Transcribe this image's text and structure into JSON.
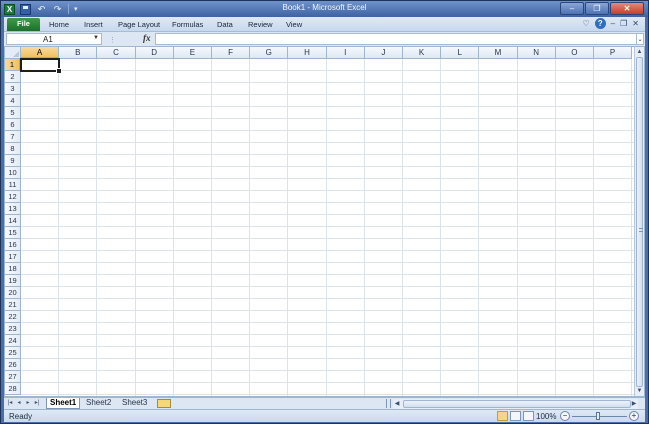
{
  "window": {
    "title": "Book1 - Microsoft Excel",
    "controls": [
      "–",
      "❐",
      "✕"
    ]
  },
  "quick_access": {
    "logo": "X",
    "undo": "↶",
    "redo": "↷",
    "more": "▾"
  },
  "ribbon": {
    "tabs": [
      "File",
      "Home",
      "Insert",
      "Page Layout",
      "Formulas",
      "Data",
      "Review",
      "View"
    ],
    "right_icons": [
      "♡",
      "?",
      "–",
      "❐",
      "✕"
    ]
  },
  "formula_bar": {
    "name_box": "A1",
    "fx": "fx",
    "value": ""
  },
  "grid": {
    "columns": [
      "A",
      "B",
      "C",
      "D",
      "E",
      "F",
      "G",
      "H",
      "I",
      "J",
      "K",
      "L",
      "M",
      "N",
      "O",
      "P"
    ],
    "rows": [
      "1",
      "2",
      "3",
      "4",
      "5",
      "6",
      "7",
      "8",
      "9",
      "10",
      "11",
      "12",
      "13",
      "14",
      "15",
      "16",
      "17",
      "18",
      "19",
      "20",
      "21",
      "22",
      "23",
      "24",
      "25",
      "26",
      "27",
      "28"
    ],
    "selected_cell": "A1",
    "selected_column": "A",
    "selected_row": "1"
  },
  "sheet_tabs": {
    "tabs": [
      "Sheet1",
      "Sheet2",
      "Sheet3"
    ],
    "active": "Sheet1",
    "nav": [
      "|◂",
      "◂",
      "▸",
      "▸|"
    ]
  },
  "status_bar": {
    "status": "Ready",
    "zoom": "100%",
    "zoom_minus": "−",
    "zoom_plus": "+"
  },
  "colors": {
    "title_bar": "#3e62a1",
    "file_tab": "#1c6f2a",
    "selected_header": "#f1c15f",
    "gridline": "#dde3ea"
  }
}
